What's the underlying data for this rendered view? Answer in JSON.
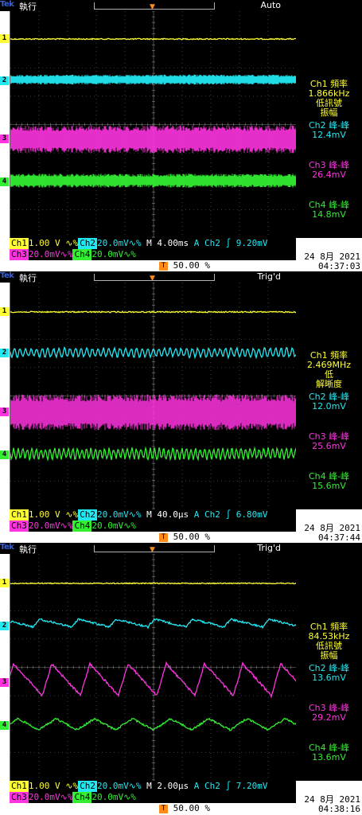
{
  "colors": {
    "ch1": "#ffff33",
    "ch2": "#22e8f2",
    "ch3": "#ff33e0",
    "ch4": "#33ee33",
    "trigger": "#ff8c1a",
    "grid": "#8a8a8a"
  },
  "shots": [
    {
      "tek": "Tek",
      "run_state": "執行",
      "trigger_mode": "Auto",
      "measurements": [
        {
          "label": "Ch1 頻率",
          "value": "1.866kHz",
          "note1": "低訊號",
          "note2": "振幅",
          "color": "#ffff33"
        },
        {
          "label": "Ch2 峰-峰",
          "value": "12.4mV",
          "color": "#22e8f2"
        },
        {
          "label": "Ch3 峰-峰",
          "value": "26.4mV",
          "color": "#ff33e0"
        },
        {
          "label": "Ch4 峰-峰",
          "value": "14.8mV",
          "color": "#33ee33"
        }
      ],
      "row1": {
        "ch1": "Ch1",
        "ch1_scale": "1.00 V ∿%",
        "ch2": "Ch2",
        "ch2_scale": "20.0mV∿%",
        "timebase": "M 4.00ms",
        "trig_src": "A  Ch2 ∫ 9.20mV"
      },
      "row2": {
        "ch3": "Ch3",
        "ch3_scale": "20.0mV∿%",
        "ch4": "Ch4",
        "ch4_scale": "20.0mV∿%"
      },
      "trigger_pos": "50.00 %",
      "date": "24 8月  2021",
      "time": "04:37:03",
      "trigger_box": "T",
      "channel_markers": [
        "1",
        "2",
        "3",
        "4"
      ]
    },
    {
      "tek": "Tek",
      "run_state": "執行",
      "trigger_mode": "Trig'd",
      "measurements": [
        {
          "label": "Ch1 頻率",
          "value": "2.469MHz",
          "note1": "低",
          "note2": "解晰度",
          "color": "#ffff33"
        },
        {
          "label": "Ch2 峰-峰",
          "value": "12.0mV",
          "color": "#22e8f2"
        },
        {
          "label": "Ch3 峰-峰",
          "value": "25.6mV",
          "color": "#ff33e0"
        },
        {
          "label": "Ch4 峰-峰",
          "value": "15.6mV",
          "color": "#33ee33"
        }
      ],
      "row1": {
        "ch1": "Ch1",
        "ch1_scale": "1.00 V ∿%",
        "ch2": "Ch2",
        "ch2_scale": "20.0mV∿%",
        "timebase": "M 40.0μs",
        "trig_src": "A  Ch2 ∫ 6.80mV"
      },
      "row2": {
        "ch3": "Ch3",
        "ch3_scale": "20.0mV∿%",
        "ch4": "Ch4",
        "ch4_scale": "20.0mV∿%"
      },
      "trigger_pos": "50.00 %",
      "date": "24 8月  2021",
      "time": "04:37:44",
      "trigger_box": "T",
      "channel_markers": [
        "1",
        "2",
        "3",
        "4"
      ]
    },
    {
      "tek": "Tek",
      "run_state": "執行",
      "trigger_mode": "Trig'd",
      "measurements": [
        {
          "label": "Ch1 頻率",
          "value": "84.53kHz",
          "note1": "低訊號",
          "note2": "振幅",
          "color": "#ffff33"
        },
        {
          "label": "Ch2 峰-峰",
          "value": "13.6mV",
          "color": "#22e8f2"
        },
        {
          "label": "Ch3 峰-峰",
          "value": "29.2mV",
          "color": "#ff33e0"
        },
        {
          "label": "Ch4 峰-峰",
          "value": "13.6mV",
          "color": "#33ee33"
        }
      ],
      "row1": {
        "ch1": "Ch1",
        "ch1_scale": "1.00 V ∿%",
        "ch2": "Ch2",
        "ch2_scale": "20.0mV∿%",
        "timebase": "M 2.00μs",
        "trig_src": "A  Ch2 ∫ 7.20mV"
      },
      "row2": {
        "ch3": "Ch3",
        "ch3_scale": "20.0mV∿%",
        "ch4": "Ch4",
        "ch4_scale": "20.0mV∿%"
      },
      "trigger_pos": "50.00 %",
      "date": "24 8月  2021",
      "time": "04:38:16",
      "trigger_box": "T",
      "channel_markers": [
        "1",
        "2",
        "3",
        "4"
      ]
    }
  ]
}
